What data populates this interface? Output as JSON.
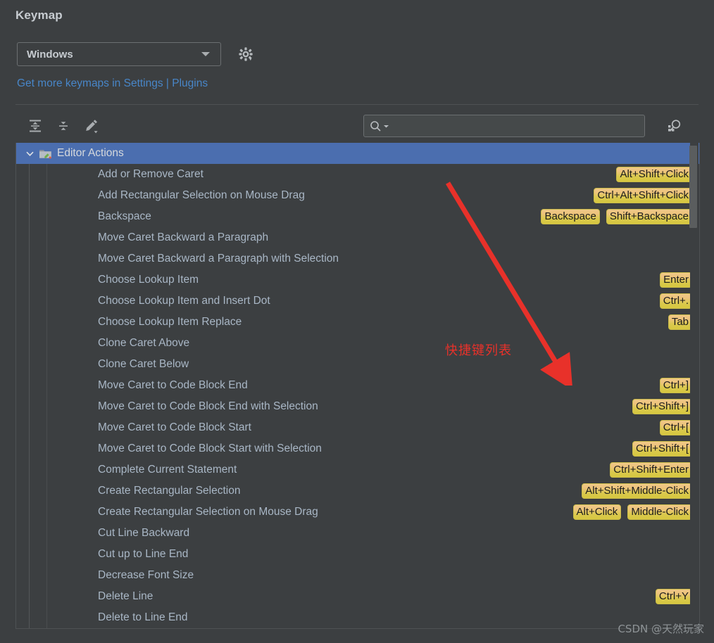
{
  "header": {
    "title": "Keymap",
    "keymap_select": {
      "value": "Windows",
      "icon": "chevron-down-icon"
    },
    "gear_icon": "gear-icon",
    "link_prefix": "Get more keymaps in Settings | Plugins"
  },
  "toolbar": {
    "expand_all_icon": "expand-all-icon",
    "collapse_all_icon": "collapse-all-icon",
    "edit_icon": "edit-pencil-icon",
    "search": {
      "value": "",
      "placeholder": "",
      "icon": "search-icon"
    },
    "find_by_shortcut_icon": "find-by-shortcut-icon"
  },
  "tree": {
    "group": {
      "label": "Editor Actions",
      "expanded": true,
      "icon": "folder-edit-icon"
    },
    "rows": [
      {
        "label": "Add or Remove Caret",
        "shortcuts": [
          "Alt+Shift+Click"
        ]
      },
      {
        "label": "Add Rectangular Selection on Mouse Drag",
        "shortcuts": [
          "Ctrl+Alt+Shift+Click"
        ]
      },
      {
        "label": "Backspace",
        "shortcuts": [
          "Backspace",
          "Shift+Backspace"
        ]
      },
      {
        "label": "Move Caret Backward a Paragraph",
        "shortcuts": []
      },
      {
        "label": "Move Caret Backward a Paragraph with Selection",
        "shortcuts": []
      },
      {
        "label": "Choose Lookup Item",
        "shortcuts": [
          "Enter"
        ]
      },
      {
        "label": "Choose Lookup Item and Insert Dot",
        "shortcuts": [
          "Ctrl+."
        ]
      },
      {
        "label": "Choose Lookup Item Replace",
        "shortcuts": [
          "Tab"
        ]
      },
      {
        "label": "Clone Caret Above",
        "shortcuts": []
      },
      {
        "label": "Clone Caret Below",
        "shortcuts": []
      },
      {
        "label": "Move Caret to Code Block End",
        "shortcuts": [
          "Ctrl+]"
        ]
      },
      {
        "label": "Move Caret to Code Block End with Selection",
        "shortcuts": [
          "Ctrl+Shift+]"
        ]
      },
      {
        "label": "Move Caret to Code Block Start",
        "shortcuts": [
          "Ctrl+["
        ]
      },
      {
        "label": "Move Caret to Code Block Start with Selection",
        "shortcuts": [
          "Ctrl+Shift+["
        ]
      },
      {
        "label": "Complete Current Statement",
        "shortcuts": [
          "Ctrl+Shift+Enter"
        ]
      },
      {
        "label": "Create Rectangular Selection",
        "shortcuts": [
          "Alt+Shift+Middle-Click"
        ]
      },
      {
        "label": "Create Rectangular Selection on Mouse Drag",
        "shortcuts": [
          "Alt+Click",
          "Middle-Click"
        ]
      },
      {
        "label": "Cut Line Backward",
        "shortcuts": []
      },
      {
        "label": "Cut up to Line End",
        "shortcuts": []
      },
      {
        "label": "Decrease Font Size",
        "shortcuts": []
      },
      {
        "label": "Delete Line",
        "shortcuts": [
          "Ctrl+Y"
        ]
      },
      {
        "label": "Delete to Line End",
        "shortcuts": []
      }
    ]
  },
  "scrollbar": {
    "orientation": "vertical"
  },
  "annotation": {
    "text": "快捷键列表",
    "color": "#e8312a",
    "arrow_icon": "red-arrow-icon"
  },
  "watermark": {
    "text": "CSDN @天然玩家"
  },
  "colors": {
    "background": "#3c3f41",
    "selection": "#4b6eaf",
    "link": "#4886c8",
    "badge_top": "#f0c987",
    "badge_bottom": "#d6c73f",
    "text": "#a9b7c6"
  }
}
